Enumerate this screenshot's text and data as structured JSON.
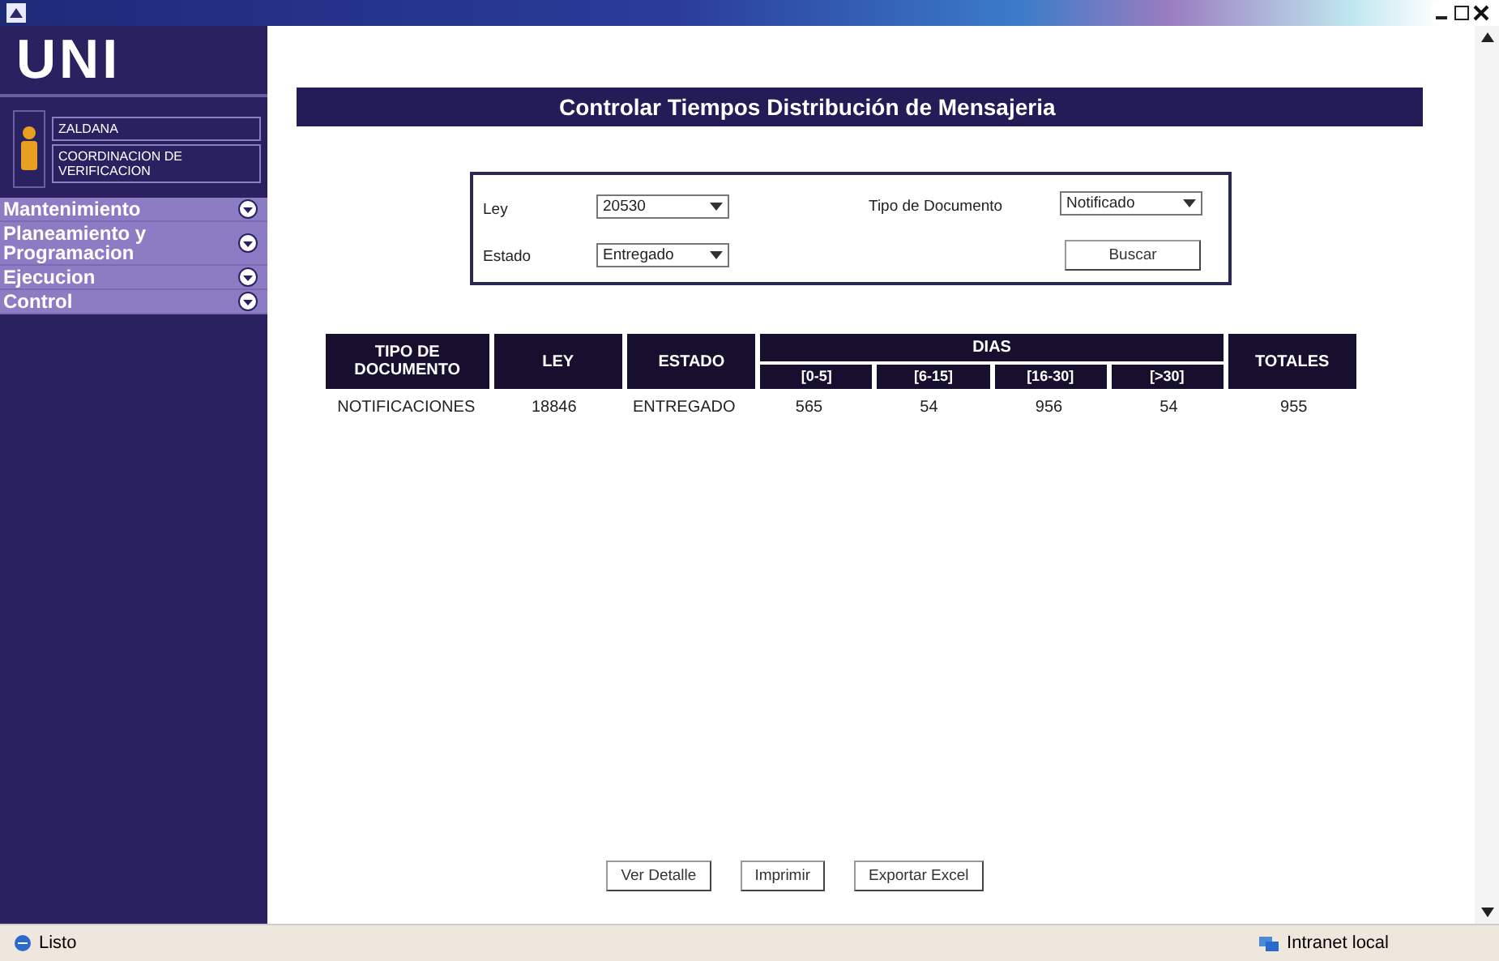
{
  "logo": "UNI",
  "user": {
    "name": "ZALDANA",
    "unit": "COORDINACION DE VERIFICACION"
  },
  "menu": [
    {
      "label": "Mantenimiento"
    },
    {
      "label": "Planeamiento y Programacion"
    },
    {
      "label": "Ejecucion"
    },
    {
      "label": "Control"
    }
  ],
  "page_title": "Controlar Tiempos Distribución de Mensajeria",
  "filters": [
    {
      "label": "Ley",
      "value": "20530"
    },
    {
      "label": "Tipo de Documento",
      "value": "Notificado"
    },
    {
      "label": "Estado",
      "value": "Entregado"
    }
  ],
  "search_button": "Buscar",
  "table": {
    "group_header": "DIAS",
    "columns": [
      {
        "label": "TIPO DE DOCUMENTO",
        "grouped": false
      },
      {
        "label": "LEY",
        "grouped": false
      },
      {
        "label": "ESTADO",
        "grouped": false
      },
      {
        "label": "[0-5]",
        "grouped": true
      },
      {
        "label": "[6-15]",
        "grouped": true
      },
      {
        "label": "[16-30]",
        "grouped": true
      },
      {
        "label": "[>30]",
        "grouped": true
      },
      {
        "label": "TOTALES",
        "grouped": false
      }
    ],
    "rows": [
      [
        "NOTIFICACIONES",
        "18846",
        "ENTREGADO",
        "565",
        "54",
        "956",
        "54",
        "955"
      ]
    ]
  },
  "buttons": [
    "Ver Detalle",
    "Imprimir",
    "Exportar Excel"
  ],
  "status_bar": {
    "text": "Listo",
    "zone": "Intranet local"
  }
}
